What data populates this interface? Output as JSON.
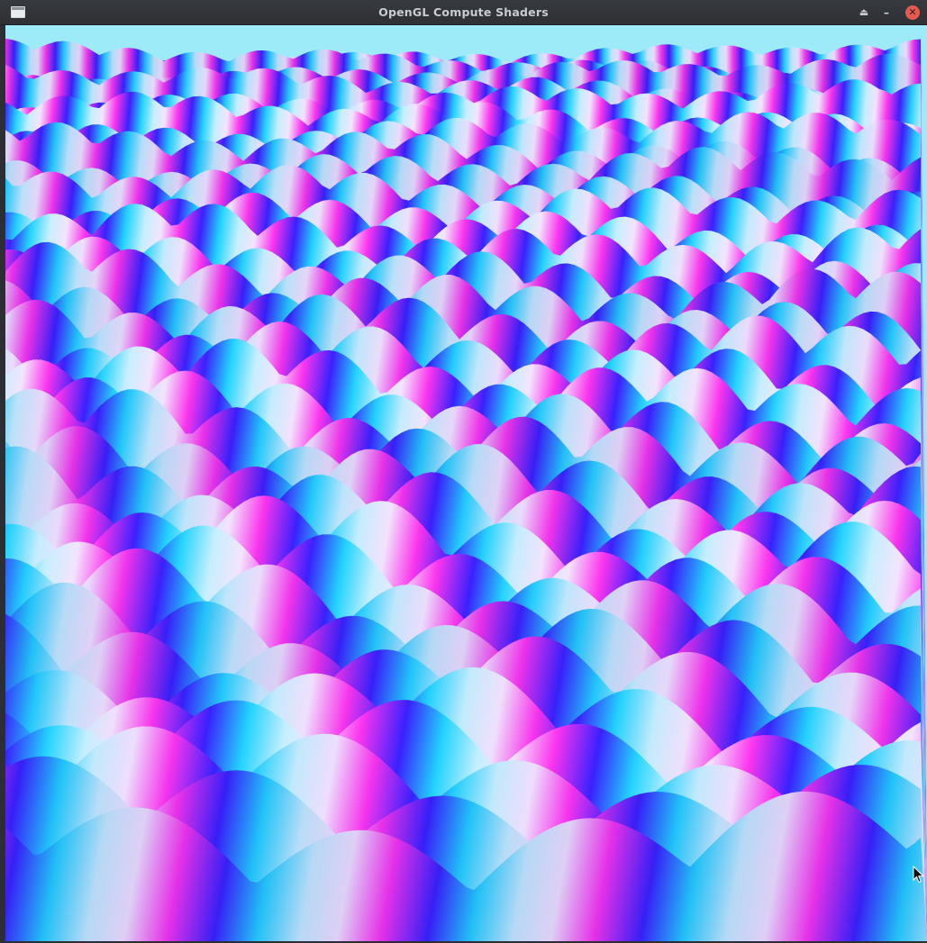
{
  "window": {
    "title": "OpenGL Compute Shaders",
    "buttons": {
      "shade": "⏏",
      "minimize": "–",
      "close": "✕"
    }
  },
  "scene": {
    "sky_color": "#9deaf8",
    "palette": [
      "#f7e7ff",
      "#ff35f0",
      "#2f1cff",
      "#22d6ff",
      "#b8eeff"
    ]
  }
}
